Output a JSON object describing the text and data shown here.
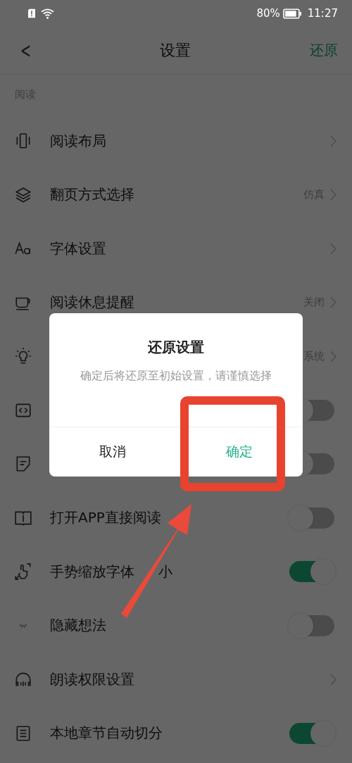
{
  "status_bar": {
    "battery": "80%",
    "time": "11:27"
  },
  "header": {
    "back": "<",
    "title": "设置",
    "action": "还原"
  },
  "section": "阅读",
  "rows": [
    {
      "kind": "link",
      "label": "阅读布局"
    },
    {
      "kind": "link",
      "label": "翻页方式选择",
      "value": "仿真"
    },
    {
      "kind": "link",
      "label": "字体设置"
    },
    {
      "kind": "link",
      "label": "阅读休息提醒",
      "value": "关闭"
    },
    {
      "kind": "link",
      "value": "系统"
    },
    {
      "kind": "toggle",
      "on": false
    },
    {
      "kind": "toggle",
      "on": false
    },
    {
      "kind": "toggle",
      "label": "打开APP直接阅读",
      "on": false
    },
    {
      "kind": "toggle",
      "label": "手势缩放字体",
      "label_tail": "小",
      "on": true
    },
    {
      "kind": "toggle",
      "label": "隐藏想法",
      "on": false
    },
    {
      "kind": "link",
      "label": "朗读权限设置"
    },
    {
      "kind": "toggle",
      "label": "本地章节自动切分",
      "on": true
    }
  ],
  "dialog": {
    "title": "还原设置",
    "message": "确定后将还原至初始设置，请谨慎选择",
    "buttons": [
      {
        "kind": "cancel",
        "label": "取消"
      },
      {
        "kind": "confirm",
        "label": "确定"
      }
    ]
  }
}
